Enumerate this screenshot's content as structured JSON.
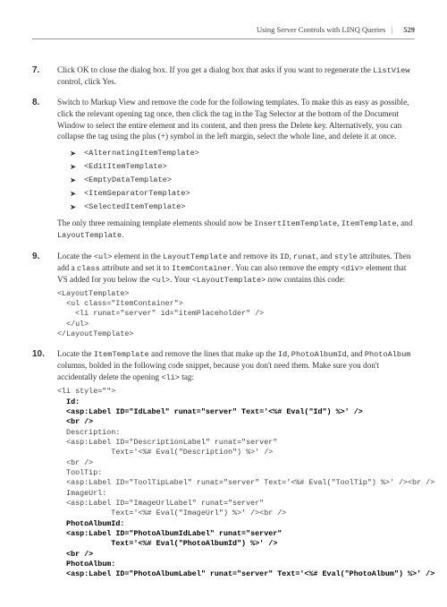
{
  "header": {
    "title": "Using Server Controls with LINQ Queries",
    "pagenum": "529"
  },
  "steps": [
    {
      "num": "7.",
      "html": "Click OK to close the dialog box. If you get a dialog box that asks if you want to regenerate the <span class='code-inline'>ListView</span> control, click Yes."
    },
    {
      "num": "8.",
      "html": "Switch to Markup View and remove the code for the following templates. To make this as easy as possible, click the relevant opening tag once, then click the tag in the Tag Selector at the bottom of the Document Window to select the entire element and its content, and then press the Delete key. Alternatively, you can collapse the tag using the plus (+) symbol in the left margin, select the whole line, and delete it at once.",
      "bullets": [
        "<AlternatingItemTemplate>",
        "<EditItemTemplate>",
        "<EmptyDataTemplate>",
        "<ItemSeparatorTemplate>",
        "<SelectedItemTemplate>"
      ],
      "after_html": "The only three remaining template elements should now be <span class='code-inline'>InsertItemTemplate</span>, <span class='code-inline'>ItemTemplate</span>, and <span class='code-inline'>LayoutTemplate</span>."
    },
    {
      "num": "9.",
      "html": "Locate the <span class='code-inline'>&lt;ul&gt;</span> element in the <span class='code-inline'>LayoutTemplate</span> and remove its <span class='code-inline'>ID</span>, <span class='code-inline'>runat</span>, and <span class='code-inline'>style</span> attributes. Then add a <span class='code-inline'>class</span> attribute and set it to <span class='code-inline'>ItemContainer</span>. You can also remove the empty <span class='code-inline'>&lt;div&gt;</span> element that VS added for you below the <span class='code-inline'>&lt;ul&gt;</span>. Your <span class='code-inline'>&lt;LayoutTemplate&gt;</span> now contains this code:",
      "code": "<LayoutTemplate>\n  <ul class=\"ItemContainer\">\n    <li runat=\"server\" id=\"itemPlaceholder\" />\n  </ul>\n</LayoutTemplate>"
    },
    {
      "num": "10.",
      "html": "Locate the <span class='code-inline'>ItemTemplate</span> and remove the lines that make up the <span class='code-inline'>Id</span>, <span class='code-inline'>PhotoAlbumId</span>, and <span class='code-inline'>PhotoAlbum</span> columns, bolded in the following code snippet, because you don't need them. Make sure you don't accidentally delete the opening <span class='code-inline'>&lt;li&gt;</span> tag:",
      "code_rich": [
        {
          "t": "<li style=\"\">",
          "b": false
        },
        {
          "t": "  Id:",
          "b": true
        },
        {
          "t": "  <asp:Label ID=\"IdLabel\" runat=\"server\" Text='<%# Eval(\"Id\") %>' />",
          "b": true
        },
        {
          "t": "  <br />",
          "b": true
        },
        {
          "t": "  Description:",
          "b": false
        },
        {
          "t": "  <asp:Label ID=\"DescriptionLabel\" runat=\"server\"",
          "b": false
        },
        {
          "t": "            Text='<%# Eval(\"Description\") %>' />",
          "b": false
        },
        {
          "t": "  <br />",
          "b": false
        },
        {
          "t": "  ToolTip:",
          "b": false
        },
        {
          "t": "  <asp:Label ID=\"ToolTipLabel\" runat=\"server\" Text='<%# Eval(\"ToolTip\") %>' /><br />",
          "b": false
        },
        {
          "t": "  ImageUrl:",
          "b": false
        },
        {
          "t": "  <asp:Label ID=\"ImageUrlLabel\" runat=\"server\"",
          "b": false
        },
        {
          "t": "            Text='<%# Eval(\"ImageUrl\") %>' /><br />",
          "b": false
        },
        {
          "t": "  PhotoAlbumId:",
          "b": true
        },
        {
          "t": "  <asp:Label ID=\"PhotoAlbumIdLabel\" runat=\"server\"",
          "b": true
        },
        {
          "t": "            Text='<%# Eval(\"PhotoAlbumId\") %>' />",
          "b": true
        },
        {
          "t": "  <br />",
          "b": true
        },
        {
          "t": "  PhotoAlbum:",
          "b": true
        },
        {
          "t": "  <asp:Label ID=\"PhotoAlbumLabel\" runat=\"server\" Text='<%# Eval(\"PhotoAlbum\") %>' />",
          "b": true
        }
      ]
    }
  ]
}
